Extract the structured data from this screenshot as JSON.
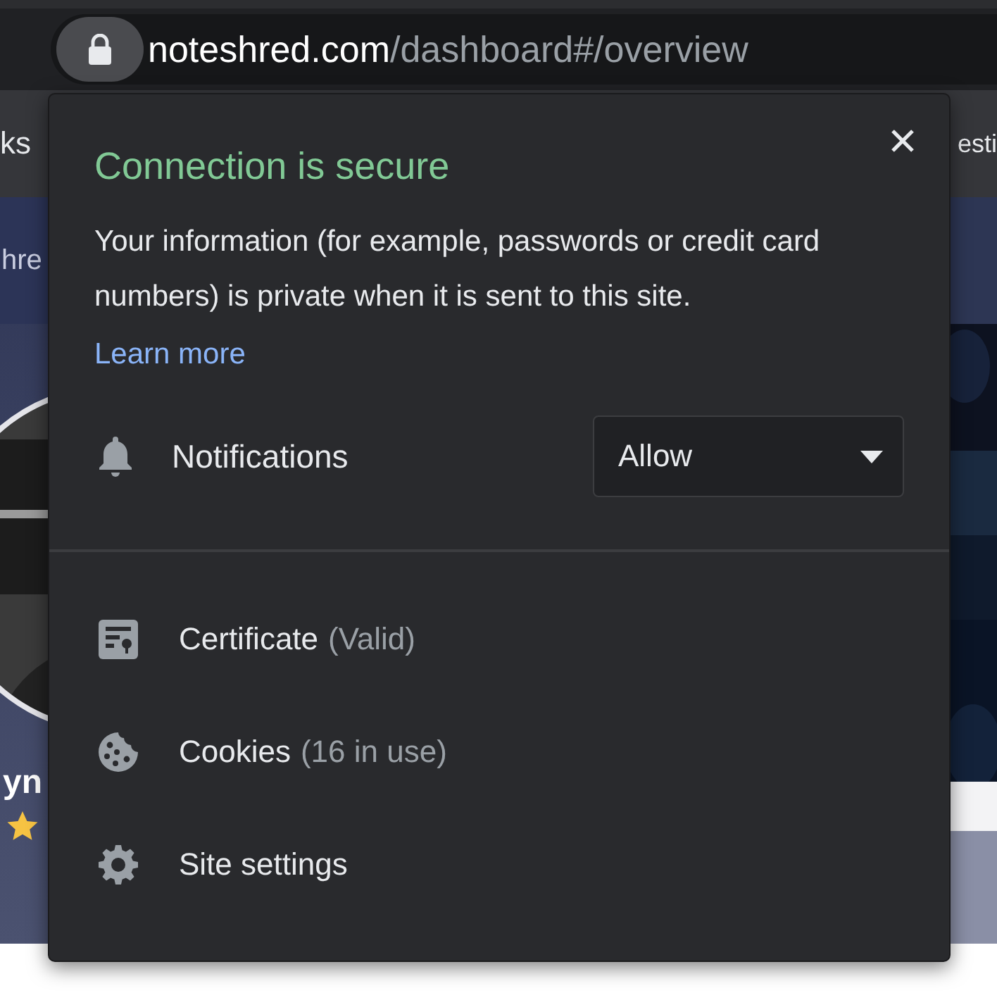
{
  "browser": {
    "url_host": "noteshred.com",
    "url_path": "/dashboard#/overview"
  },
  "bookmarks": [
    "ks",
    "esti"
  ],
  "page": {
    "heading_fragment": "hre",
    "name_fragment": "yn"
  },
  "popup": {
    "title": "Connection is secure",
    "description": "Your information (for example, passwords or credit card numbers) is private when it is sent to this site.",
    "link": "Learn more",
    "permissions": [
      {
        "label": "Notifications",
        "value": "Allow"
      }
    ],
    "items": [
      {
        "kind": "certificate",
        "label": "Certificate",
        "detail": "(Valid)"
      },
      {
        "kind": "cookies",
        "label": "Cookies",
        "detail": "(16 in use)"
      },
      {
        "kind": "settings",
        "label": "Site settings"
      }
    ]
  }
}
